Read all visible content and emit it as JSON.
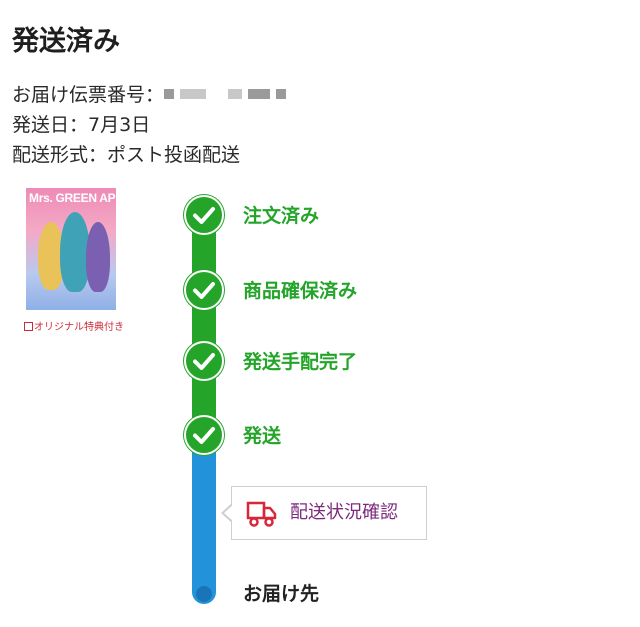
{
  "header": {
    "title": "発送済み"
  },
  "shipment": {
    "tracking_label": "お届け伝票番号：",
    "date_label": "発送日：",
    "date_value": "7月3日",
    "method_label": "配送形式：",
    "method_value": "ポスト投函配送"
  },
  "product": {
    "thumbnail_title": "Mrs. GREEN APPLE",
    "caption": "オリジナル特典付き"
  },
  "timeline": {
    "steps": [
      {
        "label": "注文済み",
        "status": "done"
      },
      {
        "label": "商品確保済み",
        "status": "done"
      },
      {
        "label": "発送手配完了",
        "status": "done"
      },
      {
        "label": "発送",
        "status": "done"
      }
    ],
    "final_label": "お届け先",
    "tracking_button_label": "配送状況確認"
  },
  "colors": {
    "done": "#24a52a",
    "pending": "#2293db",
    "link": "#7b2a7e",
    "truck": "#d8263a"
  },
  "icons": {
    "step": "check-icon",
    "tracking_button": "truck-icon",
    "caption": "gift-icon"
  }
}
